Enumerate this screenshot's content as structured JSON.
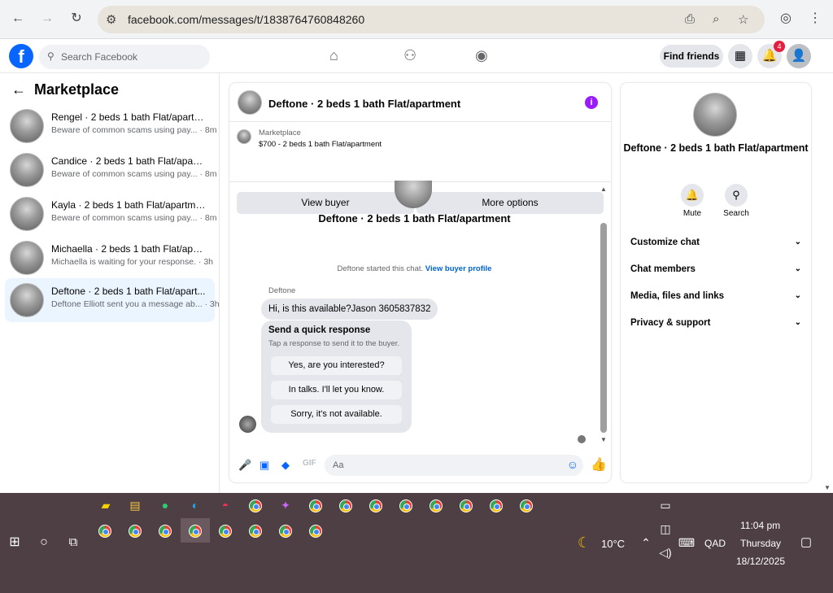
{
  "browser": {
    "url": "facebook.com/messages/t/1838764760848260"
  },
  "header": {
    "search_placeholder": "Search Facebook",
    "find_friends": "Find friends",
    "notif_count": "4",
    "logo": "f"
  },
  "sidebar": {
    "title": "Marketplace",
    "items": [
      {
        "title": "Rengel · 2 beds 1 bath Flat/apartm...",
        "snippet": "Beware of common scams using pay... · 8m",
        "active": false
      },
      {
        "title": "Candice · 2 beds 1 bath Flat/apart...",
        "snippet": "Beware of common scams using pay... · 8m",
        "active": false
      },
      {
        "title": "Kayla · 2 beds 1 bath Flat/apartment",
        "snippet": "Beware of common scams using pay... · 8m",
        "active": false
      },
      {
        "title": "Michaella · 2 beds 1 bath Flat/apar...",
        "snippet": "Michaella is waiting for your response. · 3h",
        "active": false
      },
      {
        "title": "Deftone · 2 beds 1 bath Flat/apart...",
        "snippet": "Deftone Elliott sent you a message ab... · 3h",
        "active": true
      }
    ]
  },
  "chat": {
    "title": "Deftone · 2 beds 1 bath Flat/apartment",
    "marketplace_label": "Marketplace",
    "listing": "$700 - 2 beds 1 bath Flat/apartment",
    "view_buyer": "View buyer",
    "more_options": "More options",
    "header_name": "Deftone · 2 beds 1 bath Flat/apartment",
    "system_text": "Deftone started this chat.",
    "system_link": "View buyer profile",
    "sender": "Deftone",
    "message": "Hi, is this available?Jason 3605837832",
    "quick_title": "Send a quick response",
    "quick_sub": "Tap a response to send it to the buyer.",
    "quick_responses": [
      "Yes, are you interested?",
      "In talks. I'll let you know.",
      "Sorry, it's not available."
    ],
    "input_placeholder": "Aa"
  },
  "details": {
    "name": "Deftone · 2 beds 1 bath Flat/apartment",
    "mute": "Mute",
    "search": "Search",
    "rows": [
      "Customize chat",
      "Chat members",
      "Media, files and links",
      "Privacy & support"
    ]
  },
  "taskbar": {
    "weather": "10°C",
    "lang": "QAD",
    "time": "11:04 pm",
    "day": "Thursday",
    "date": "18/12/2025"
  }
}
